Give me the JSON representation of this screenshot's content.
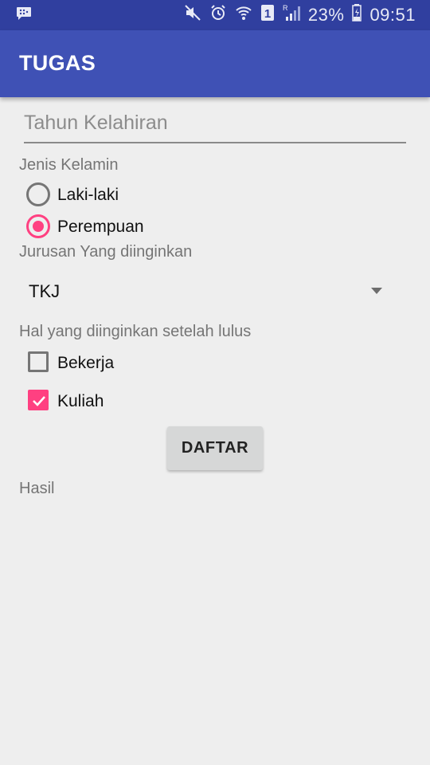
{
  "status_bar": {
    "battery_percent": "23%",
    "time": "09:51",
    "sim_label": "1",
    "icons": [
      "messenger-icon",
      "mute-icon",
      "alarm-icon",
      "wifi-icon",
      "sim-icon",
      "signal-icon",
      "battery-icon"
    ]
  },
  "app_bar": {
    "title": "TUGAS"
  },
  "form": {
    "year_placeholder": "Tahun Kelahiran",
    "year_value": "",
    "gender_label": "Jenis Kelamin",
    "gender_options": [
      {
        "label": "Laki-laki",
        "checked": false
      },
      {
        "label": "Perempuan",
        "checked": true
      }
    ],
    "major_label": "Jurusan Yang diinginkan",
    "major_selected": "TKJ",
    "goal_label": "Hal yang diinginkan setelah lulus",
    "goal_options": [
      {
        "label": "Bekerja",
        "checked": false
      },
      {
        "label": "Kuliah",
        "checked": true
      }
    ],
    "submit_label": "DAFTAR",
    "result_text": "Hasil"
  },
  "colors": {
    "status_bar": "#303f9f",
    "primary": "#3f51b5",
    "accent": "#ff4081",
    "background": "#eeeeee"
  }
}
